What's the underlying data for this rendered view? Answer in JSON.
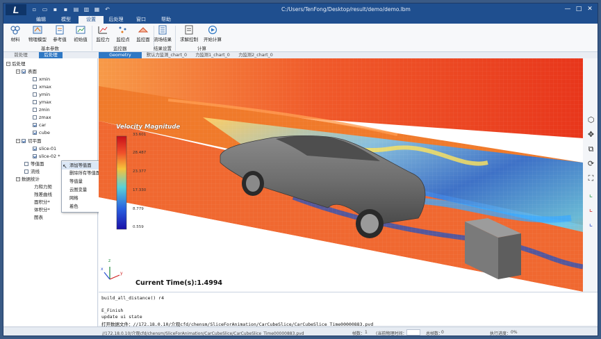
{
  "titlebar": {
    "logo": "L",
    "path": "C:/Users/TenFong/Desktop/result/demo/demo.lbm",
    "min": "—",
    "max": "□",
    "close": "✕"
  },
  "menu": {
    "tabs": [
      "编辑",
      "模型",
      "设置",
      "后处理",
      "窗口",
      "帮助"
    ],
    "active": "设置"
  },
  "ribbon": {
    "buttons": [
      "材料",
      "物理模型",
      "参考值",
      "初始值",
      "监控力",
      "监控点",
      "监控面",
      "流场结果",
      "求解控制",
      "开始计算"
    ],
    "groups": [
      "基本参数",
      "监控器",
      "结果设置",
      "计算"
    ]
  },
  "left_tabs": [
    "前处理",
    "后处理"
  ],
  "tree": {
    "root": "后处理",
    "surfaces": "表面",
    "surface_items": [
      "xmin",
      "xmax",
      "ymin",
      "ymax",
      "zmin",
      "zmax",
      "car",
      "cube"
    ],
    "slices": "切平面",
    "slice_items": [
      "slice-01",
      "slice-02 *"
    ],
    "iso": "等值面",
    "stream": "流线",
    "stats": "数据统计",
    "stats_items": [
      "力和力矩",
      "残差曲线",
      "面积分*",
      "体积分*",
      "图表"
    ]
  },
  "context_menu": {
    "items": [
      "添加等值面",
      "删除所有等值面",
      "等值量",
      "云图变量",
      "网格",
      "着色"
    ]
  },
  "view_tabs": [
    "Geometry",
    "默认力监测_chart_0",
    "力监测1_chart_0",
    "力监测2_chart_0"
  ],
  "viewport": {
    "colorbar_title": "Velocity Magnitude",
    "colorbar_labels": [
      "33.601",
      "28.487",
      "23.377",
      "17.330",
      "8.779",
      "0.559"
    ],
    "time_label": "Current Time(s):1.4994",
    "axis_labels": [
      "z",
      "y",
      "x"
    ]
  },
  "console": {
    "lines": [
      "build_all_distance() r4",
      "",
      "E_Finish",
      "update ui state",
      "打开数据文件：//172.18.0.10/介观cfd/chensm/SliceForAnimation/CarCubeSlice/CarCubeSlice_Time00000883.pvd"
    ]
  },
  "status": {
    "file": "//172.18.0.10/介观cfd/chensm/SliceForAnimation/CarCubeSlice/CarCubeSlice_Time00000883.pvd",
    "frame_label": "帧数：",
    "frame_value": "1",
    "time_label": "(当前物理时间：0)",
    "total_label": "总帧数：",
    "total_value": "0",
    "progress_label": "执行进度：",
    "progress_value": "0%"
  },
  "colors": {
    "title_blue": "#1f4f8f",
    "accent": "#2f78c4",
    "flow_red": "#e63a1c",
    "flow_orange": "#f58a2a"
  }
}
